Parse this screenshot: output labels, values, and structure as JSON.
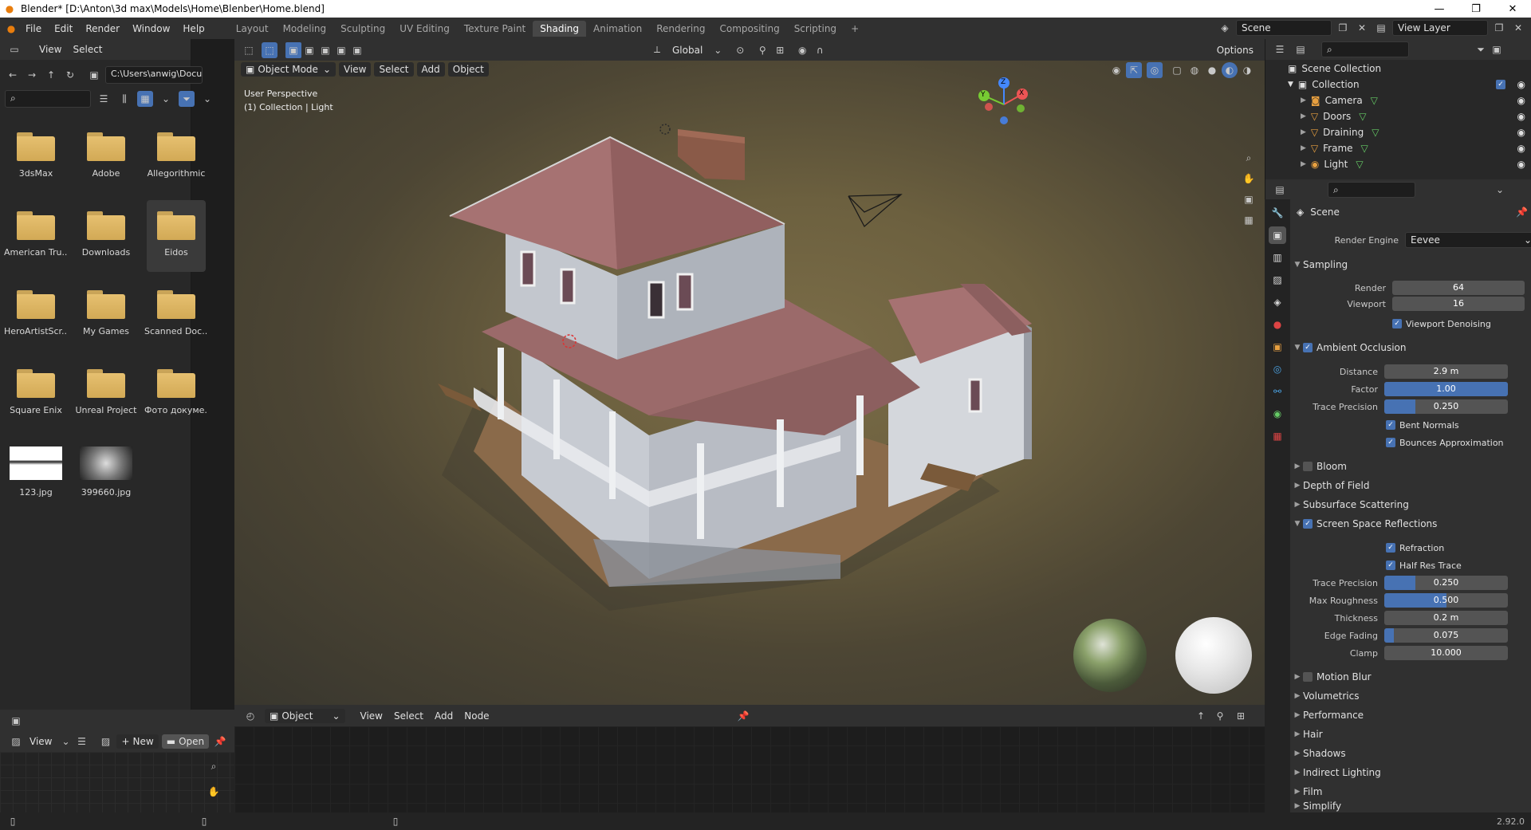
{
  "window": {
    "title": "Blender* [D:\\Anton\\3d max\\Models\\Home\\Blenber\\Home.blend]",
    "buttons": [
      "—",
      "❐",
      "✕"
    ]
  },
  "topbar": {
    "menus": [
      "File",
      "Edit",
      "Render",
      "Window",
      "Help"
    ],
    "workspaces": [
      "Layout",
      "Modeling",
      "Sculpting",
      "UV Editing",
      "Texture Paint",
      "Shading",
      "Animation",
      "Rendering",
      "Compositing",
      "Scripting"
    ],
    "active_workspace": "Shading",
    "scene": "Scene",
    "view_layer": "View Layer"
  },
  "filebrowser": {
    "header": {
      "view": "View",
      "select": "Select"
    },
    "path": "C:\\Users\\anwig\\Docu...",
    "items": [
      {
        "label": "3dsMax",
        "type": "folder"
      },
      {
        "label": "Adobe",
        "type": "folder"
      },
      {
        "label": "Allegorithmic",
        "type": "folder"
      },
      {
        "label": "American Tru...",
        "type": "folder"
      },
      {
        "label": "Downloads",
        "type": "folder"
      },
      {
        "label": "Eidos",
        "type": "folder"
      },
      {
        "label": "HeroArtistScr...",
        "type": "folder"
      },
      {
        "label": "My Games",
        "type": "folder"
      },
      {
        "label": "Scanned Doc...",
        "type": "folder"
      },
      {
        "label": "Square Enix",
        "type": "folder"
      },
      {
        "label": "Unreal Project",
        "type": "folder"
      },
      {
        "label": "Фото докуме...",
        "type": "folder"
      },
      {
        "label": "123.jpg",
        "type": "image"
      },
      {
        "label": "399660.jpg",
        "type": "image"
      }
    ]
  },
  "viewport": {
    "global": "Global",
    "options": "Options",
    "mode": "Object Mode",
    "menus": [
      "View",
      "Select",
      "Add",
      "Object"
    ],
    "overlay_text": [
      "User Perspective",
      "(1) Collection | Light"
    ],
    "gizmo": {
      "x": "X",
      "y": "Y",
      "z": "Z"
    }
  },
  "node_editor": {
    "object": "Object",
    "menus": [
      "View",
      "Select",
      "Add",
      "Node"
    ]
  },
  "image_editor": {
    "view": "View",
    "new": "New",
    "open": "Open"
  },
  "outliner": {
    "root": "Scene Collection",
    "collection": "Collection",
    "items": [
      "Camera",
      "Doors",
      "Draining",
      "Frame",
      "Light"
    ]
  },
  "properties": {
    "context": "Scene",
    "render_engine_label": "Render Engine",
    "render_engine": "Eevee",
    "sampling": {
      "title": "Sampling",
      "render_label": "Render",
      "render": "64",
      "viewport_label": "Viewport",
      "viewport": "16",
      "denoise": "Viewport Denoising"
    },
    "ao": {
      "title": "Ambient Occlusion",
      "distance_label": "Distance",
      "distance": "2.9 m",
      "factor_label": "Factor",
      "factor": "1.00",
      "factor_fill": 1.0,
      "trace_label": "Trace Precision",
      "trace": "0.250",
      "trace_fill": 0.25,
      "bent": "Bent Normals",
      "bounces": "Bounces Approximation"
    },
    "collapsed1": [
      "Bloom",
      "Depth of Field",
      "Subsurface Scattering"
    ],
    "ssr": {
      "title": "Screen Space Reflections",
      "refraction": "Refraction",
      "halfres": "Half Res Trace",
      "trace_label": "Trace Precision",
      "trace": "0.250",
      "trace_fill": 0.25,
      "rough_label": "Max Roughness",
      "rough": "0.500",
      "rough_fill": 0.5,
      "thick_label": "Thickness",
      "thick": "0.2 m",
      "fade_label": "Edge Fading",
      "fade": "0.075",
      "fade_fill": 0.075,
      "clamp_label": "Clamp",
      "clamp": "10.000"
    },
    "collapsed2": [
      "Motion Blur",
      "Volumetrics",
      "Performance",
      "Hair",
      "Shadows",
      "Indirect Lighting",
      "Film",
      "Simplify"
    ]
  },
  "status": {
    "version": "2.92.0"
  },
  "colors": {
    "accent": "#4772b3",
    "folder": "#e2bb6a",
    "active_tab": "#474747"
  }
}
